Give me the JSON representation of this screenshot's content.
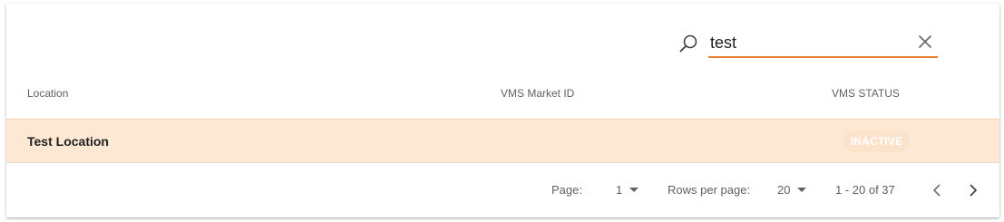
{
  "search": {
    "value": "test",
    "icon": "search-icon",
    "clear_icon": "close-icon",
    "accent_color": "#ed7d31"
  },
  "table": {
    "columns": [
      "Location",
      "VMS Market ID",
      "VMS STATUS"
    ],
    "rows": [
      {
        "location": "Test Location",
        "market_id": "",
        "status": "INACTIVE"
      }
    ],
    "row_highlight_color": "#fde8d4"
  },
  "pagination": {
    "page_label": "Page:",
    "page_value": "1",
    "rows_label": "Rows per page:",
    "rows_value": "20",
    "range": "1 - 20 of 37",
    "prev_icon": "chevron-left-icon",
    "next_icon": "chevron-right-icon"
  }
}
